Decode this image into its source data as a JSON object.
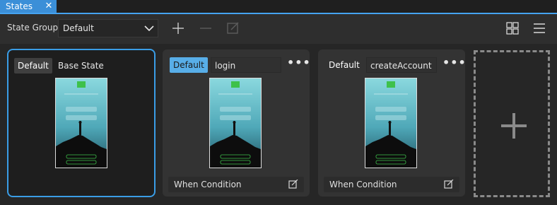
{
  "panel": {
    "tab_title": "States",
    "tab_close": "✕"
  },
  "toolbar": {
    "state_group_label": "State Group",
    "state_group_value": "Default",
    "add_icon": "plus-icon",
    "remove_icon": "minus-icon",
    "edit_icon": "edit-icon",
    "grid_view_icon": "grid-icon",
    "menu_icon": "menu-icon"
  },
  "states": [
    {
      "default_label": "Default",
      "name": "Base State",
      "is_base": true,
      "selected": true
    },
    {
      "default_label": "Default",
      "name": "login",
      "is_default": true,
      "condition_label": "When Condition",
      "more": "•••"
    },
    {
      "default_label": "Default",
      "name": "createAccount",
      "is_default": false,
      "condition_label": "When Condition",
      "more": "•••"
    }
  ],
  "thumbnail": {
    "logo": "Qt",
    "sky_color": "#7fd0d8",
    "ground_color": "#0d0d0d",
    "accent_color": "#3ec14b"
  },
  "add_state_icon": "plus-icon",
  "colors": {
    "accent": "#3a9de6",
    "default_active": "#58aee8"
  }
}
